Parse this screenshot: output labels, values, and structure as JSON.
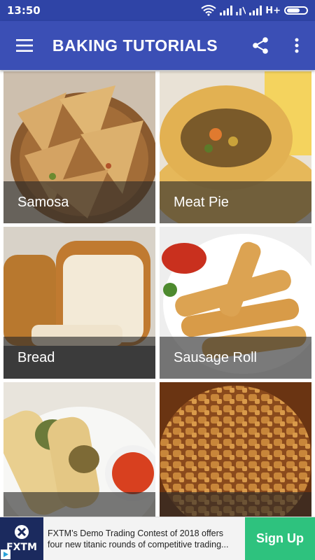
{
  "status_bar": {
    "time": "13:50",
    "network": "H+"
  },
  "app_bar": {
    "title": "BAKING TUTORIALS",
    "menu_icon": "hamburger-menu-icon",
    "share_icon": "share-icon",
    "overflow_icon": "more-vert-icon"
  },
  "recipes": [
    {
      "label": "Samosa"
    },
    {
      "label": "Meat Pie"
    },
    {
      "label": "Bread"
    },
    {
      "label": "Sausage Roll"
    },
    {
      "label": ""
    },
    {
      "label": ""
    }
  ],
  "ad": {
    "logo_text": "FXTM",
    "text": "FXTM’s Demo Trading Contest of 2018 offers four new titanic rounds of competitive trading...",
    "cta": "Sign Up"
  },
  "colors": {
    "status_bar": "#2f44a6",
    "app_bar": "#3b4fb5",
    "ad_cta": "#2ec27e",
    "ad_logo_bg": "#1b2a5e"
  }
}
